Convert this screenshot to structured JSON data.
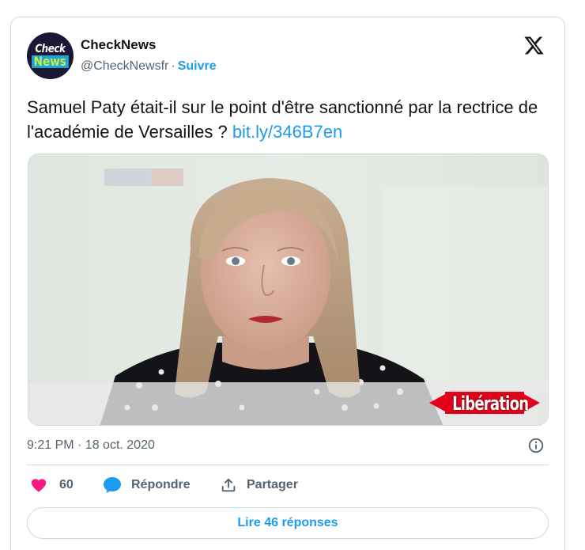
{
  "author": {
    "avatar_line1": "Check",
    "avatar_line2": "News",
    "name": "CheckNews",
    "handle": "@CheckNewsfr",
    "separator": "·",
    "follow_label": "Suivre"
  },
  "tweet": {
    "text": "Samuel Paty était-il sur le point d'être sanctionné par la rectrice de l'académie de Versailles ?",
    "link": "bit.ly/346B7en",
    "media_watermark": "Libération",
    "timestamp": "9:21 PM · 18 oct. 2020"
  },
  "actions": {
    "like_count": "60",
    "reply_label": "Répondre",
    "share_label": "Partager",
    "read_replies_label": "Lire 46 réponses"
  },
  "icons": {
    "platform": "x-logo-icon",
    "like": "heart-icon",
    "reply": "speech-bubble-icon",
    "share": "share-upload-icon",
    "info": "info-icon"
  },
  "colors": {
    "accent": "#1d9bf0",
    "like": "#f91880",
    "text": "#0f1419",
    "muted": "#536471",
    "border": "#cfd9de"
  }
}
